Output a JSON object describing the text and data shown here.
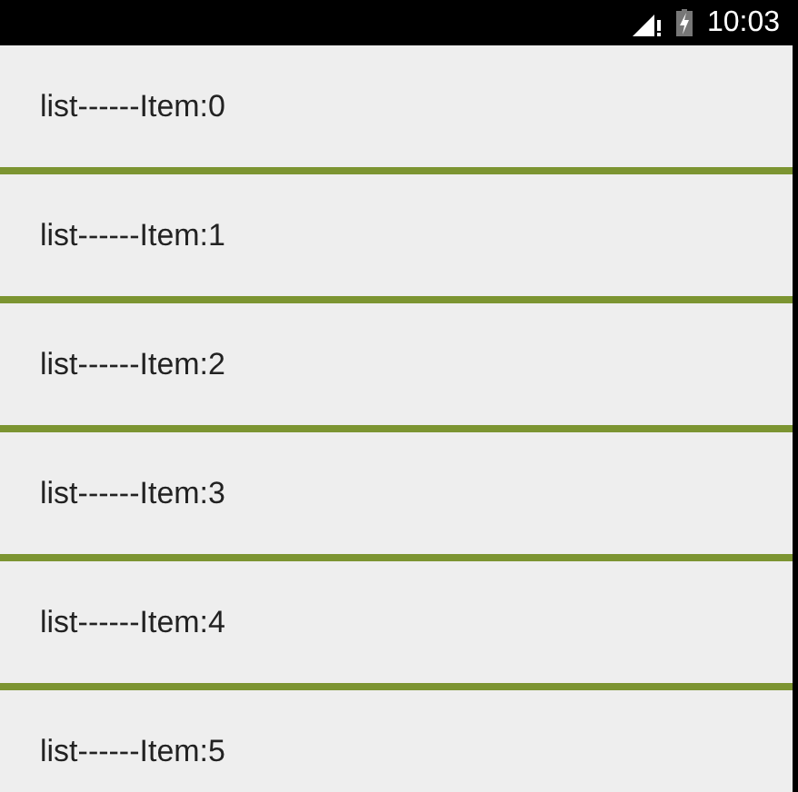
{
  "status_bar": {
    "time": "10:03"
  },
  "list": [
    {
      "label": "list------Item:0"
    },
    {
      "label": "list------Item:1"
    },
    {
      "label": "list------Item:2"
    },
    {
      "label": "list------Item:3"
    },
    {
      "label": "list------Item:4"
    },
    {
      "label": "list------Item:5"
    }
  ]
}
